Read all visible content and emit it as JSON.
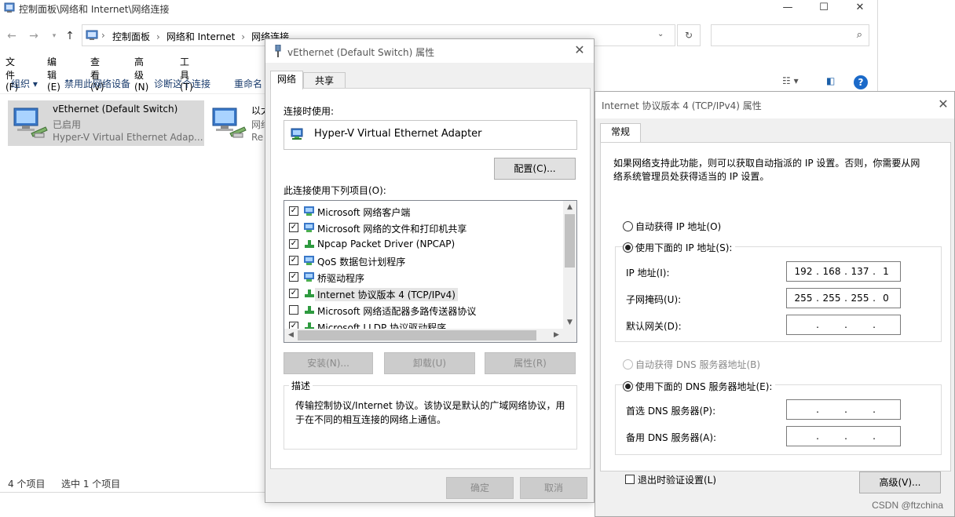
{
  "explorer": {
    "title": "控制面板\\网络和 Internet\\网络连接",
    "breadcrumbs": [
      "控制面板",
      "网络和 Internet",
      "网络连接"
    ],
    "menu": [
      "文件(F)",
      "编辑(E)",
      "查看(V)",
      "高级(N)",
      "工具(T)"
    ],
    "commands": [
      "组织 ▾",
      "禁用此网络设备",
      "诊断这个连接",
      "重命名"
    ],
    "items": [
      {
        "name": "vEthernet (Default Switch)",
        "status": "已启用",
        "adapter": "Hyper-V Virtual Ethernet Adap..."
      },
      {
        "name": "以太",
        "status": "网络",
        "adapter": "Re"
      }
    ],
    "status_left": "4 个项目",
    "status_right": "选中 1 个项目"
  },
  "props": {
    "title": "vEthernet (Default Switch) 属性",
    "tabs": [
      "网络",
      "共享"
    ],
    "connect_using_label": "连接时使用:",
    "adapter": "Hyper-V Virtual Ethernet Adapter",
    "configure_button": "配置(C)...",
    "items_label": "此连接使用下列项目(O):",
    "components": [
      {
        "label": "Microsoft 网络客户端",
        "checked": true
      },
      {
        "label": "Microsoft 网络的文件和打印机共享",
        "checked": true
      },
      {
        "label": "Npcap Packet Driver (NPCAP)",
        "checked": true
      },
      {
        "label": "QoS 数据包计划程序",
        "checked": true
      },
      {
        "label": "桥驱动程序",
        "checked": true
      },
      {
        "label": "Internet 协议版本 4 (TCP/IPv4)",
        "checked": true
      },
      {
        "label": "Microsoft 网络适配器多路传送器协议",
        "checked": false
      },
      {
        "label": "Microsoft LLDP 协议驱动程序",
        "checked": true
      }
    ],
    "install_button": "安装(N)...",
    "uninstall_button": "卸载(U)",
    "properties_button": "属性(R)",
    "description_legend": "描述",
    "description": "传输控制协议/Internet 协议。该协议是默认的广域网络协议，用于在不同的相互连接的网络上通信。",
    "ok_button": "确定",
    "cancel_button": "取消"
  },
  "ipv4": {
    "title": "Internet 协议版本 4 (TCP/IPv4) 属性",
    "tab": "常规",
    "intro": "如果网络支持此功能，则可以获取自动指派的 IP 设置。否则，你需要从网络系统管理员处获得适当的 IP 设置。",
    "auto_ip": "自动获得 IP 地址(O)",
    "manual_ip": "使用下面的 IP 地址(S):",
    "ip_label": "IP 地址(I):",
    "ip_value": [
      "192",
      "168",
      "137",
      "1"
    ],
    "mask_label": "子网掩码(U):",
    "mask_value": [
      "255",
      "255",
      "255",
      "0"
    ],
    "gateway_label": "默认网关(D):",
    "auto_dns": "自动获得 DNS 服务器地址(B)",
    "manual_dns": "使用下面的 DNS 服务器地址(E):",
    "dns1_label": "首选 DNS 服务器(P):",
    "dns2_label": "备用 DNS 服务器(A):",
    "validate_label": "退出时验证设置(L)",
    "advanced_button": "高级(V)...",
    "watermark": "CSDN @ftzchina"
  }
}
